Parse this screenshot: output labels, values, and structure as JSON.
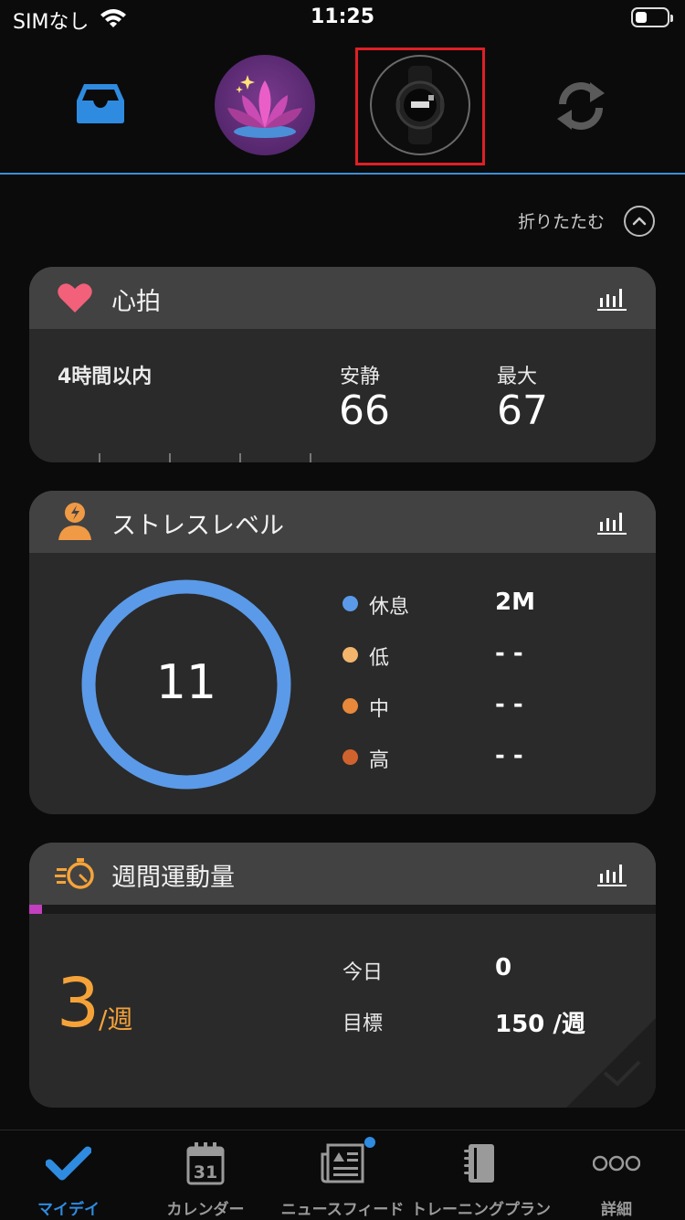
{
  "status_bar": {
    "carrier": "SIMなし",
    "time": "11:25"
  },
  "top_bar": {
    "icons": [
      "inbox-icon",
      "lotus-avatar-icon",
      "watch-device-icon",
      "sync-icon"
    ]
  },
  "collapse": {
    "label": "折りたたむ"
  },
  "heart_rate": {
    "title": "心拍",
    "period": "4時間以内",
    "resting_label": "安静",
    "resting_value": "66",
    "max_label": "最大",
    "max_value": "67"
  },
  "stress": {
    "title": "ストレスレベル",
    "score": "11",
    "score_fraction": 1.0,
    "legend": [
      {
        "label": "休息",
        "value": "2M",
        "color": "#5b9ae8"
      },
      {
        "label": "低",
        "value": "- -",
        "color": "#f3b56c"
      },
      {
        "label": "中",
        "value": "- -",
        "color": "#e8883b"
      },
      {
        "label": "高",
        "value": "- -",
        "color": "#d0632d"
      }
    ]
  },
  "intensity": {
    "title": "週間運動量",
    "value": "3",
    "unit": "/週",
    "today_label": "今日",
    "today_value": "0",
    "goal_label": "目標",
    "goal_value": "150 /週",
    "progress_fraction": 0.02,
    "progress_color": "#c23fbf",
    "accent": "#f5a339"
  },
  "bottom_nav": {
    "items": [
      {
        "label": "マイデイ",
        "icon": "check-icon",
        "active": true
      },
      {
        "label": "カレンダー",
        "icon": "calendar-icon",
        "calendar_day": "31"
      },
      {
        "label": "ニュースフィード",
        "icon": "newsfeed-icon",
        "badge": true
      },
      {
        "label": "トレーニングプラン",
        "icon": "notebook-icon"
      },
      {
        "label": "詳細",
        "icon": "more-dots-icon"
      }
    ],
    "active_color": "#2f8be0"
  }
}
